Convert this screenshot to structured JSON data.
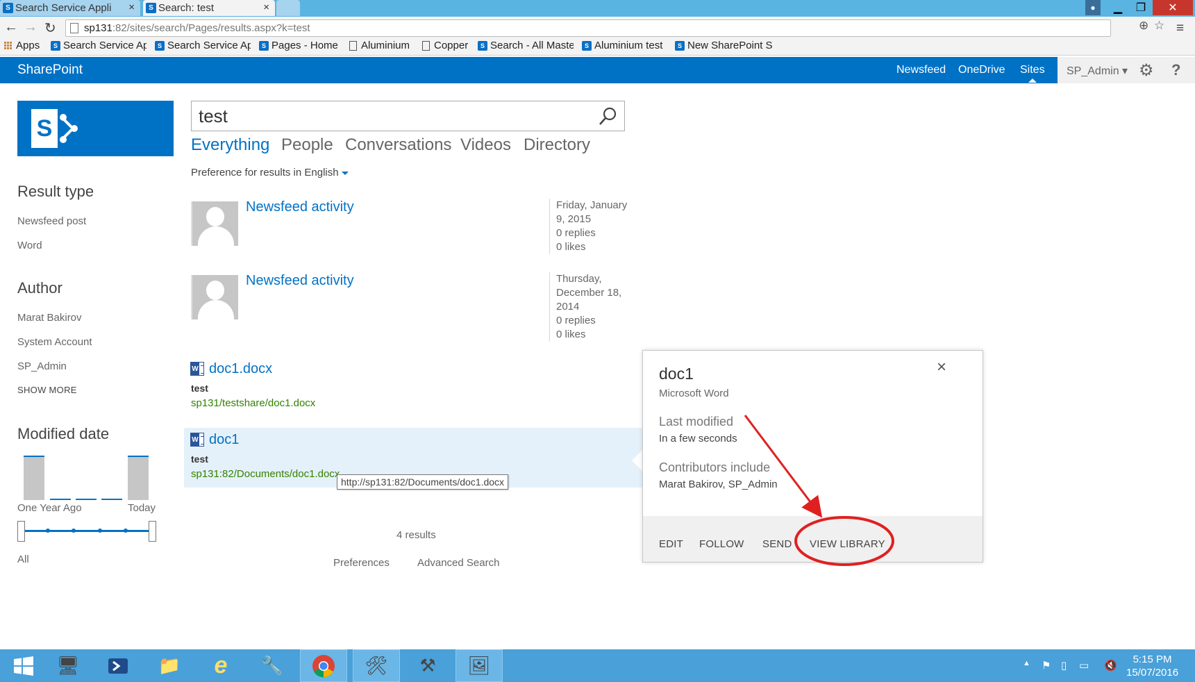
{
  "browser": {
    "tabs": [
      {
        "title": "Search Service Appli",
        "active": false
      },
      {
        "title": "Search: test",
        "active": true
      }
    ],
    "url_host": "sp131",
    "url_rest": ":82/sites/search/Pages/results.aspx?k=test",
    "bookmarks": [
      "Apps",
      "Search Service Ap",
      "Search Service Ap",
      "Pages - Home",
      "Aluminium",
      "Copper",
      "Search - All Maste",
      "Aluminium test",
      "New SharePoint S"
    ]
  },
  "suite": {
    "brand": "SharePoint",
    "links": [
      "Newsfeed",
      "OneDrive",
      "Sites"
    ],
    "user": "SP_Admin",
    "help": "?",
    "accent": "#0072c6"
  },
  "search": {
    "query": "test",
    "verticals": [
      "Everything",
      "People",
      "Conversations",
      "Videos",
      "Directory"
    ],
    "active_vertical": "Everything",
    "preference": "Preference for results in English"
  },
  "refiners": {
    "result_type": {
      "title": "Result type",
      "items": [
        "Newsfeed post",
        "Word"
      ]
    },
    "author": {
      "title": "Author",
      "items": [
        "Marat Bakirov",
        "System Account",
        "SP_Admin"
      ],
      "show_more": "SHOW MORE"
    },
    "modified": {
      "title": "Modified date",
      "start_label": "One Year Ago",
      "end_label": "Today",
      "range": "All"
    }
  },
  "results": [
    {
      "title": "Newsfeed activity",
      "meta": [
        "Friday, January",
        "9, 2015",
        "0 replies",
        "0 likes"
      ]
    },
    {
      "title": "Newsfeed activity",
      "meta": [
        "Thursday,",
        "December 18,",
        "2014",
        "0 replies",
        "0 likes"
      ]
    },
    {
      "title": "doc1.docx",
      "summary": "test",
      "url": "sp131/testshare/doc1.docx"
    },
    {
      "title": "doc1",
      "summary": "test",
      "url": "sp131:82/Documents/doc1.docx",
      "tooltip": "http://sp131:82/Documents/doc1.docx"
    }
  ],
  "result_count": "4 results",
  "footer": {
    "preferences": "Preferences",
    "advanced": "Advanced Search"
  },
  "hover_panel": {
    "title": "doc1",
    "type": "Microsoft Word",
    "last_modified_label": "Last modified",
    "last_modified": "In a few seconds",
    "contributors_label": "Contributors include",
    "contributors": "Marat Bakirov, SP_Admin",
    "actions": [
      "EDIT",
      "FOLLOW",
      "SEND",
      "VIEW LIBRARY"
    ]
  },
  "taskbar": {
    "time": "5:15 PM",
    "date": "15/07/2016"
  },
  "colors": {
    "annotation": "#e02020",
    "url_green": "#338200"
  }
}
